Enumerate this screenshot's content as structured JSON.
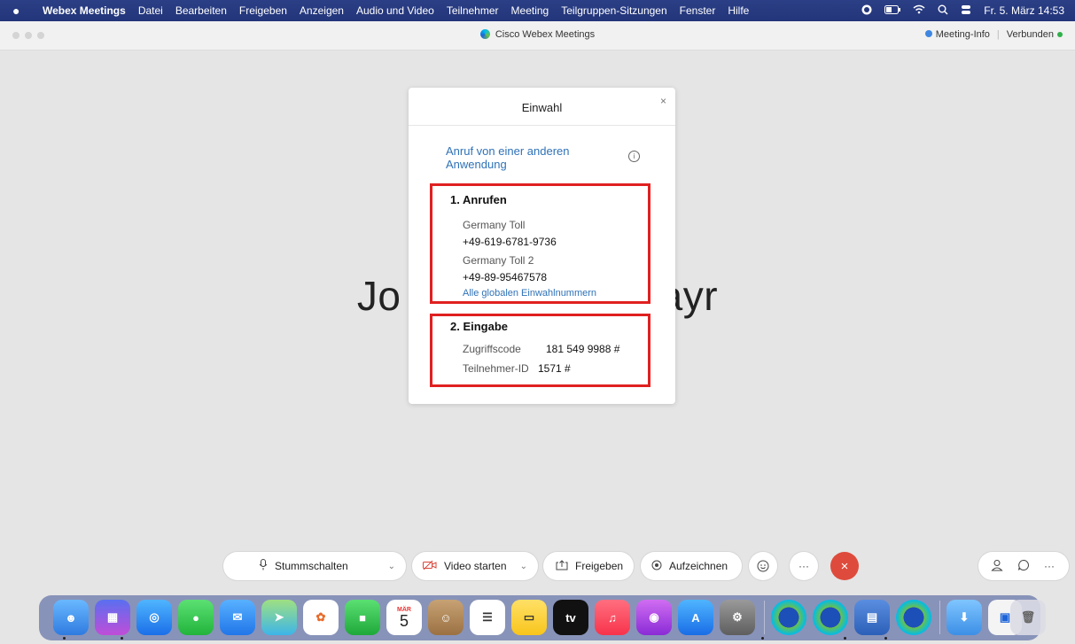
{
  "menubar": {
    "items": [
      "Webex Meetings",
      "Datei",
      "Bearbeiten",
      "Freigeben",
      "Anzeigen",
      "Audio und Video",
      "Teilnehmer",
      "Meeting",
      "Teilgruppen-Sitzungen",
      "Fenster",
      "Hilfe"
    ],
    "clock": "Fr. 5. März 14:53"
  },
  "window": {
    "title": "Cisco Webex Meetings",
    "meeting_info": "Meeting-Info",
    "status": "Verbunden"
  },
  "participant": {
    "name": "Jo                      ayr"
  },
  "dialog": {
    "title": "Einwahl",
    "close": "×",
    "call_from_app": "Anruf von einer anderen Anwendung",
    "step1": {
      "title": "1. Anrufen",
      "numbers": [
        {
          "label": "Germany Toll",
          "number": "+49-619-6781-9736"
        },
        {
          "label": "Germany Toll 2",
          "number": "+49-89-95467578"
        }
      ],
      "all_numbers_link": "Alle globalen Einwahlnummern"
    },
    "step2": {
      "title": "2. Eingabe",
      "access_code_label": "Zugriffscode",
      "access_code": "181 549 9988 #",
      "participant_id_label": "Teilnehmer-ID",
      "participant_id": "1571 #"
    }
  },
  "toolbar": {
    "mute": "Stummschalten",
    "video": "Video starten",
    "share": "Freigeben",
    "record": "Aufzeichnen",
    "more": "···",
    "end": "×"
  },
  "dock": {
    "calendar_month": "MÄR",
    "calendar_day": "5",
    "tv_label": "tv"
  }
}
